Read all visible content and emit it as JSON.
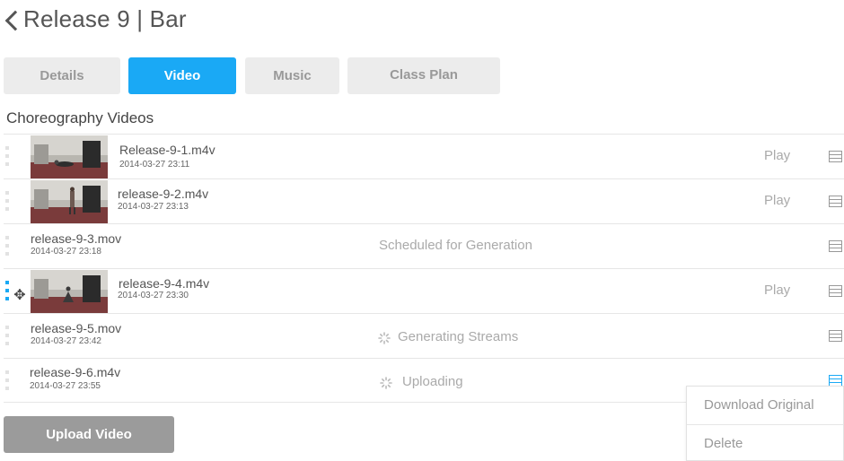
{
  "header": {
    "title": "Release 9 | Bar"
  },
  "tabs": [
    {
      "label": "Details",
      "active": false
    },
    {
      "label": "Video",
      "active": true
    },
    {
      "label": "Music",
      "active": false
    },
    {
      "label": "Class Plan",
      "active": false
    }
  ],
  "section": {
    "title": "Choreography Videos"
  },
  "videos": [
    {
      "name": "Release-9-1.m4v",
      "date": "2014-03-27 23:11",
      "has_thumbnail": true,
      "action": "Play"
    },
    {
      "name": "release-9-2.m4v",
      "date": "2014-03-27 23:13",
      "has_thumbnail": true,
      "action": "Play"
    },
    {
      "name": "release-9-3.mov",
      "date": "2014-03-27 23:18",
      "has_thumbnail": false,
      "status": "Scheduled for Generation"
    },
    {
      "name": "release-9-4.m4v",
      "date": "2014-03-27 23:30",
      "has_thumbnail": true,
      "action": "Play"
    },
    {
      "name": "release-9-5.mov",
      "date": "2014-03-27 23:42",
      "has_thumbnail": false,
      "status": "Generating Streams"
    },
    {
      "name": "release-9-6.m4v",
      "date": "2014-03-27 23:55",
      "has_thumbnail": false,
      "status": "Uploading"
    }
  ],
  "upload": {
    "label": "Upload Video"
  },
  "context_menu": {
    "items": [
      "Download Original",
      "Delete"
    ]
  },
  "icons": {
    "back": "chevron-left-icon",
    "row_menu": "hamburger-menu-icon",
    "drag": "drag-handle-icon",
    "move": "move-cursor-icon",
    "spinner": "loading-spinner-icon"
  },
  "colors": {
    "accent": "#1aa9f5",
    "tab_inactive_bg": "#ececec",
    "upload_button_bg": "#9b9b9b",
    "muted_text": "#aaaaaa"
  }
}
